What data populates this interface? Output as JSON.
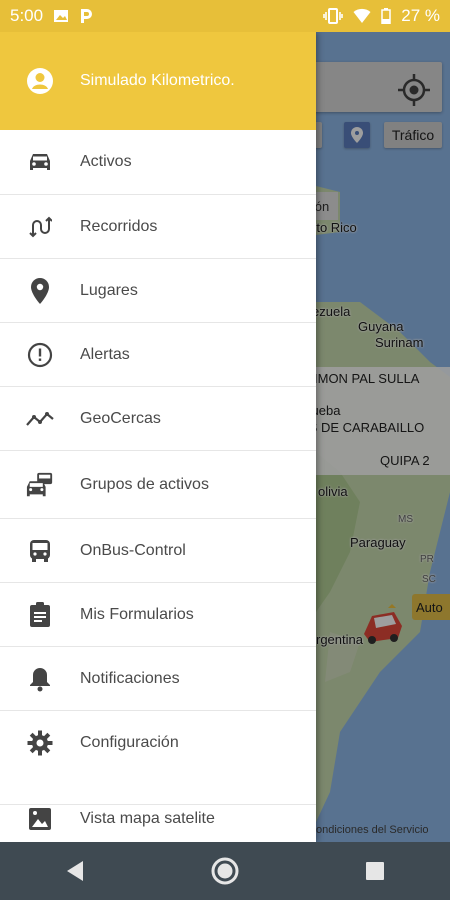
{
  "status_bar": {
    "time": "5:00",
    "icons_left": [
      "image-icon",
      "parking-p-icon"
    ],
    "icons_right": [
      "vibrate-icon",
      "wifi-icon",
      "battery-icon"
    ],
    "battery": "27 %"
  },
  "drawer": {
    "header": {
      "icon": "account-circle-icon",
      "title": "Simulado Kilometrico."
    },
    "items": [
      {
        "label": "Activos",
        "icon": "car-icon"
      },
      {
        "label": "Recorridos",
        "icon": "route-icon"
      },
      {
        "label": "Lugares",
        "icon": "location-pin-icon"
      },
      {
        "label": "Alertas",
        "icon": "alert-circle-icon"
      },
      {
        "label": "GeoCercas",
        "icon": "trend-line-icon"
      },
      {
        "label": "Grupos de activos",
        "icon": "vehicle-group-icon"
      },
      {
        "label": "OnBus-Control",
        "icon": "bus-icon"
      },
      {
        "label": "Mis Formularios",
        "icon": "clipboard-icon"
      },
      {
        "label": "Notificaciones",
        "icon": "bell-icon"
      },
      {
        "label": "Configuración",
        "icon": "gear-icon"
      },
      {
        "label": "Vista mapa satelite",
        "icon": "satellite-image-icon"
      }
    ]
  },
  "map": {
    "traffic_button": "Tráfico",
    "pill_text": "ón",
    "labels": {
      "puerto_rico": "rto Rico",
      "venezuela": "ezuela",
      "guyana": "Guyana",
      "suriname": "Surinam",
      "bolivia": "olivia",
      "ms": "MS",
      "paraguay": "Paraguay",
      "pr": "PR",
      "sc": "SC",
      "argentina": "rgentina"
    },
    "info_panel": {
      "line1": "IMON   PAL SULLA",
      "line2": "orueba",
      "line3": "AS DE CARABAILLO",
      "line4": "QUIPA   2"
    },
    "vehicle_tag": "Auto",
    "terms": "ondiciones del Servicio"
  },
  "nav_bar": {
    "icons": [
      "back-triangle-icon",
      "home-circle-icon",
      "recents-square-icon"
    ]
  }
}
